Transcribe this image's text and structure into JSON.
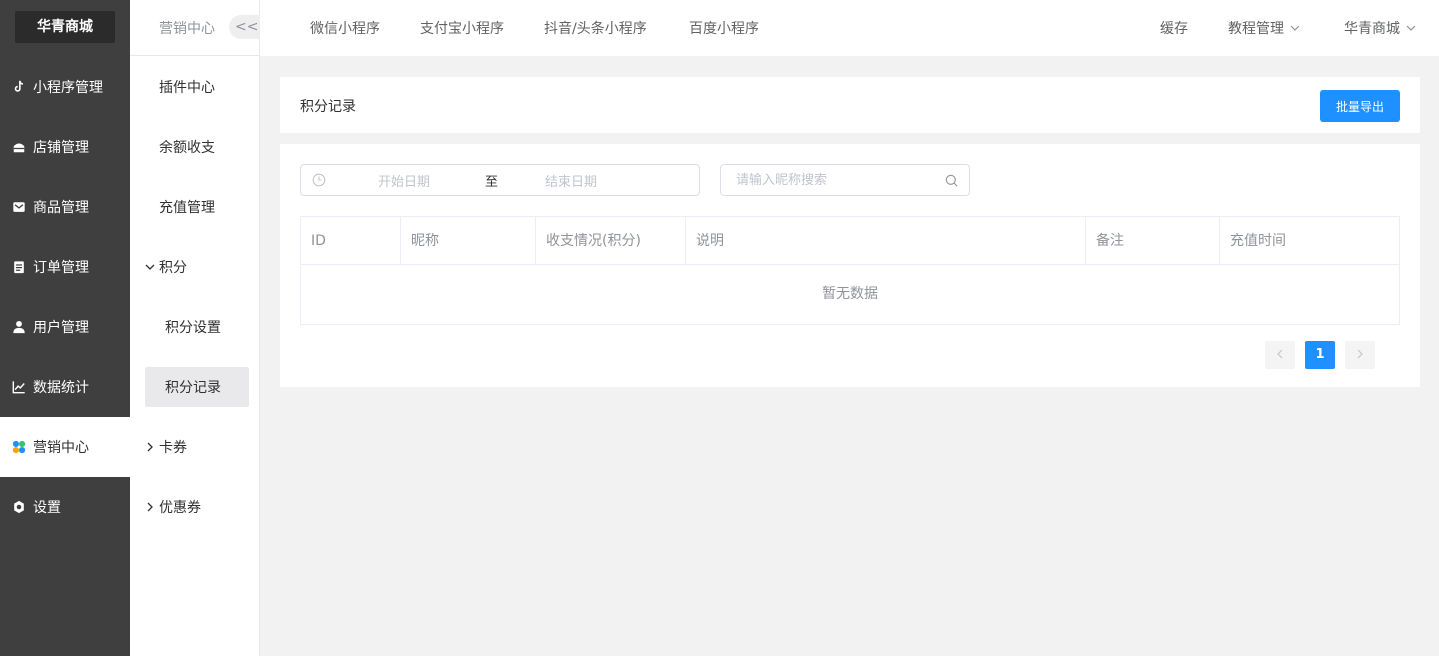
{
  "brand": "华青商城",
  "sidebar": {
    "items": [
      {
        "label": "小程序管理",
        "icon": "tiktok-icon"
      },
      {
        "label": "店铺管理",
        "icon": "store-icon"
      },
      {
        "label": "商品管理",
        "icon": "mail-icon"
      },
      {
        "label": "订单管理",
        "icon": "clipboard-icon"
      },
      {
        "label": "用户管理",
        "icon": "user-icon"
      },
      {
        "label": "数据统计",
        "icon": "chart-icon"
      },
      {
        "label": "营销中心",
        "icon": "marketing-icon"
      },
      {
        "label": "设置",
        "icon": "gear-icon"
      }
    ],
    "active": "营销中心"
  },
  "subnav": {
    "title": "营销中心",
    "collapse_label": "<<",
    "items": [
      {
        "label": "插件中心"
      },
      {
        "label": "余额收支"
      },
      {
        "label": "充值管理"
      },
      {
        "label": "积分"
      },
      {
        "label": "积分设置"
      },
      {
        "label": "积分记录"
      },
      {
        "label": "卡券"
      },
      {
        "label": "优惠券"
      }
    ]
  },
  "topnav": {
    "tabs": [
      "微信小程序",
      "支付宝小程序",
      "抖音/头条小程序",
      "百度小程序"
    ],
    "cache": "缓存",
    "tutorial": "教程管理",
    "shop": "华青商城"
  },
  "page": {
    "title": "积分记录",
    "export_label": "批量导出"
  },
  "filters": {
    "start_placeholder": "开始日期",
    "separator": "至",
    "end_placeholder": "结束日期",
    "search_placeholder": "请输入昵称搜索"
  },
  "table": {
    "columns": [
      "ID",
      "昵称",
      "收支情况(积分)",
      "说明",
      "备注",
      "充值时间"
    ],
    "empty_text": "暂无数据"
  },
  "pagination": {
    "current": "1"
  },
  "colors": {
    "accent": "#1e90ff",
    "sidebar_bg": "#3f3f3f"
  }
}
